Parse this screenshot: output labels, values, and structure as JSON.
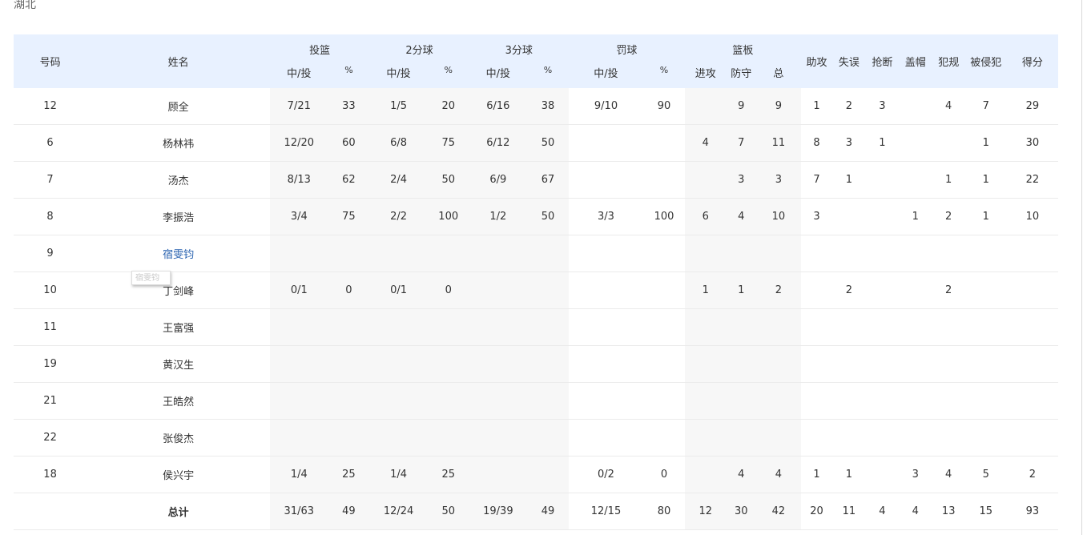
{
  "team": "湖北",
  "tooltip": "宿雯钧",
  "header": {
    "number": "号码",
    "name": "姓名",
    "groups": {
      "fg": "投篮",
      "two": "2分球",
      "three": "3分球",
      "ft": "罚球",
      "reb": "篮板"
    },
    "made_att": "中/投",
    "pct": "%",
    "reb_off": "进攻",
    "reb_def": "防守",
    "reb_tot": "总",
    "ast": "助攻",
    "tov": "失误",
    "stl": "抢断",
    "blk": "盖帽",
    "pf": "犯规",
    "fd": "被侵犯",
    "pts": "得分"
  },
  "players": [
    {
      "num": "12",
      "name": "顾全",
      "fg": "7/21",
      "fg_pct": "33",
      "two": "1/5",
      "two_pct": "20",
      "three": "6/16",
      "three_pct": "38",
      "ft": "9/10",
      "ft_pct": "90",
      "oreb": "",
      "dreb": "9",
      "reb": "9",
      "ast": "1",
      "tov": "2",
      "stl": "3",
      "blk": "",
      "pf": "4",
      "fd": "7",
      "pts": "29"
    },
    {
      "num": "6",
      "name": "杨林祎",
      "fg": "12/20",
      "fg_pct": "60",
      "two": "6/8",
      "two_pct": "75",
      "three": "6/12",
      "three_pct": "50",
      "ft": "",
      "ft_pct": "",
      "oreb": "4",
      "dreb": "7",
      "reb": "11",
      "ast": "8",
      "tov": "3",
      "stl": "1",
      "blk": "",
      "pf": "",
      "fd": "1",
      "pts": "30"
    },
    {
      "num": "7",
      "name": "汤杰",
      "fg": "8/13",
      "fg_pct": "62",
      "two": "2/4",
      "two_pct": "50",
      "three": "6/9",
      "three_pct": "67",
      "ft": "",
      "ft_pct": "",
      "oreb": "",
      "dreb": "3",
      "reb": "3",
      "ast": "7",
      "tov": "1",
      "stl": "",
      "blk": "",
      "pf": "1",
      "fd": "1",
      "pts": "22"
    },
    {
      "num": "8",
      "name": "李振浩",
      "fg": "3/4",
      "fg_pct": "75",
      "two": "2/2",
      "two_pct": "100",
      "three": "1/2",
      "three_pct": "50",
      "ft": "3/3",
      "ft_pct": "100",
      "oreb": "6",
      "dreb": "4",
      "reb": "10",
      "ast": "3",
      "tov": "",
      "stl": "",
      "blk": "1",
      "pf": "2",
      "fd": "1",
      "pts": "10"
    },
    {
      "num": "9",
      "name": "宿雯钧",
      "fg": "",
      "fg_pct": "",
      "two": "",
      "two_pct": "",
      "three": "",
      "three_pct": "",
      "ft": "",
      "ft_pct": "",
      "oreb": "",
      "dreb": "",
      "reb": "",
      "ast": "",
      "tov": "",
      "stl": "",
      "blk": "",
      "pf": "",
      "fd": "",
      "pts": ""
    },
    {
      "num": "10",
      "name": "丁剑峰",
      "fg": "0/1",
      "fg_pct": "0",
      "two": "0/1",
      "two_pct": "0",
      "three": "",
      "three_pct": "",
      "ft": "",
      "ft_pct": "",
      "oreb": "1",
      "dreb": "1",
      "reb": "2",
      "ast": "",
      "tov": "2",
      "stl": "",
      "blk": "",
      "pf": "2",
      "fd": "",
      "pts": ""
    },
    {
      "num": "11",
      "name": "王富强",
      "fg": "",
      "fg_pct": "",
      "two": "",
      "two_pct": "",
      "three": "",
      "three_pct": "",
      "ft": "",
      "ft_pct": "",
      "oreb": "",
      "dreb": "",
      "reb": "",
      "ast": "",
      "tov": "",
      "stl": "",
      "blk": "",
      "pf": "",
      "fd": "",
      "pts": ""
    },
    {
      "num": "19",
      "name": "黄汉生",
      "fg": "",
      "fg_pct": "",
      "two": "",
      "two_pct": "",
      "three": "",
      "three_pct": "",
      "ft": "",
      "ft_pct": "",
      "oreb": "",
      "dreb": "",
      "reb": "",
      "ast": "",
      "tov": "",
      "stl": "",
      "blk": "",
      "pf": "",
      "fd": "",
      "pts": ""
    },
    {
      "num": "21",
      "name": "王皓然",
      "fg": "",
      "fg_pct": "",
      "two": "",
      "two_pct": "",
      "three": "",
      "three_pct": "",
      "ft": "",
      "ft_pct": "",
      "oreb": "",
      "dreb": "",
      "reb": "",
      "ast": "",
      "tov": "",
      "stl": "",
      "blk": "",
      "pf": "",
      "fd": "",
      "pts": ""
    },
    {
      "num": "22",
      "name": "张俊杰",
      "fg": "",
      "fg_pct": "",
      "two": "",
      "two_pct": "",
      "three": "",
      "three_pct": "",
      "ft": "",
      "ft_pct": "",
      "oreb": "",
      "dreb": "",
      "reb": "",
      "ast": "",
      "tov": "",
      "stl": "",
      "blk": "",
      "pf": "",
      "fd": "",
      "pts": ""
    },
    {
      "num": "18",
      "name": "侯兴宇",
      "fg": "1/4",
      "fg_pct": "25",
      "two": "1/4",
      "two_pct": "25",
      "three": "",
      "three_pct": "",
      "ft": "0/2",
      "ft_pct": "0",
      "oreb": "",
      "dreb": "4",
      "reb": "4",
      "ast": "1",
      "tov": "1",
      "stl": "",
      "blk": "3",
      "pf": "4",
      "fd": "5",
      "pts": "2"
    }
  ],
  "totals": {
    "label": "总计",
    "fg": "31/63",
    "fg_pct": "49",
    "two": "12/24",
    "two_pct": "50",
    "three": "19/39",
    "three_pct": "49",
    "ft": "12/15",
    "ft_pct": "80",
    "oreb": "12",
    "dreb": "30",
    "reb": "42",
    "ast": "20",
    "tov": "11",
    "stl": "4",
    "blk": "4",
    "pf": "13",
    "fd": "15",
    "pts": "93"
  }
}
